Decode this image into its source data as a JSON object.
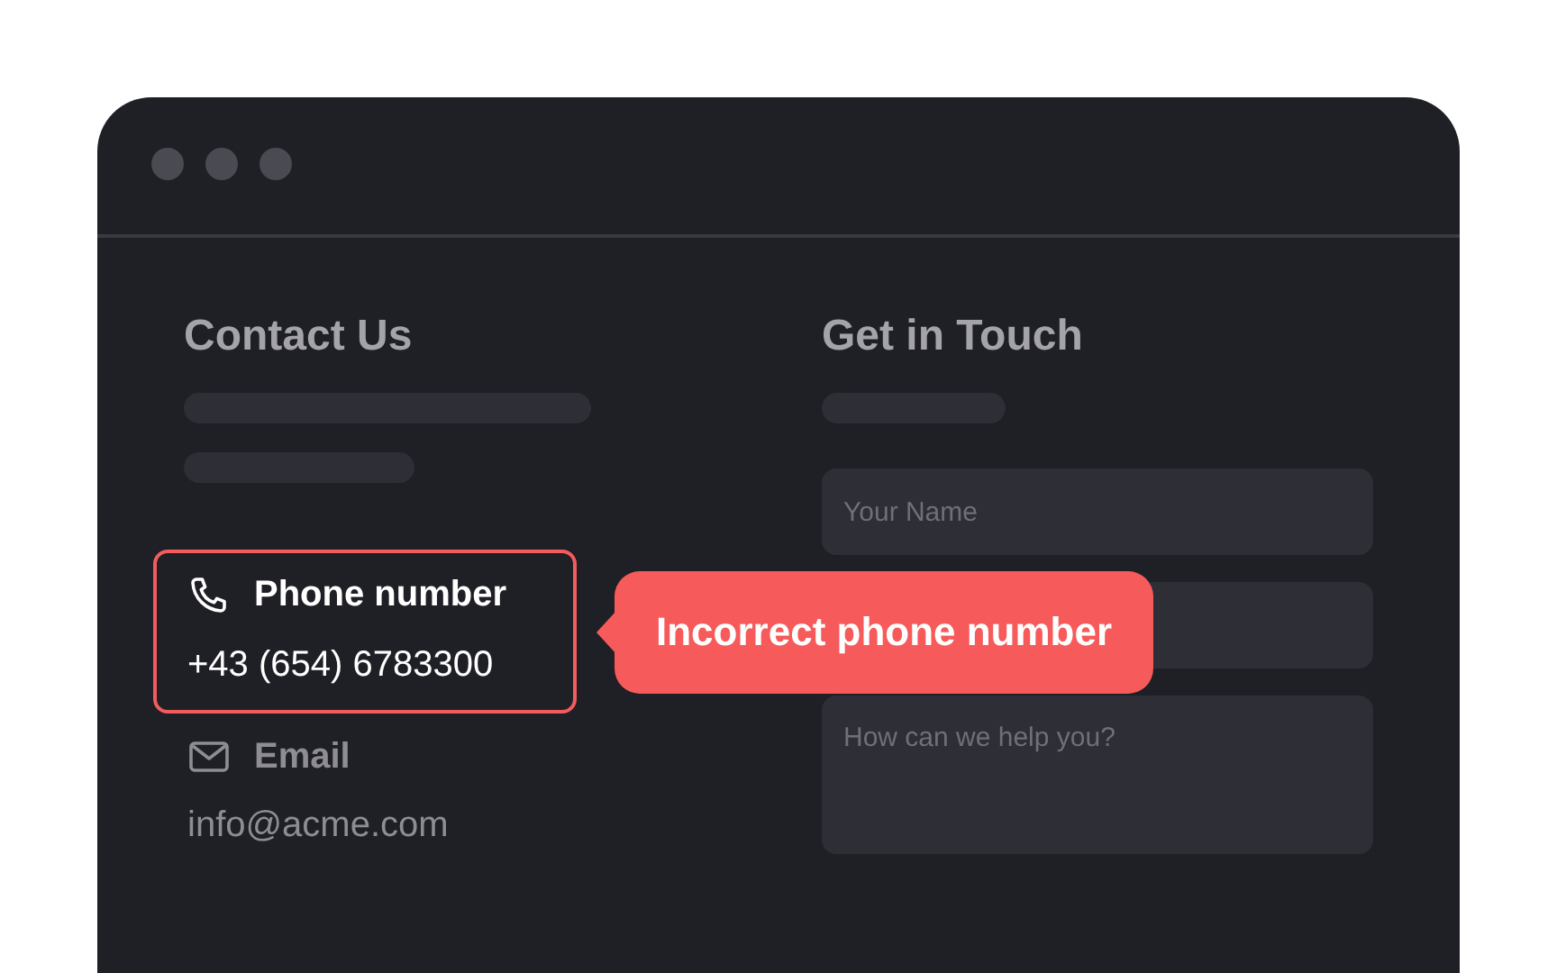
{
  "contact": {
    "title": "Contact Us",
    "items": [
      {
        "kind": "phone",
        "label": "Phone number",
        "value": "+43 (654) 6783300",
        "invalid": true
      },
      {
        "kind": "email",
        "label": "Email",
        "value": "info@acme.com",
        "invalid": false
      }
    ],
    "error_tooltip": "Incorrect phone number"
  },
  "form": {
    "title": "Get in Touch",
    "fields": [
      {
        "kind": "input",
        "placeholder": "Your Name"
      },
      {
        "kind": "input"
      },
      {
        "kind": "textarea",
        "placeholder": "How can we help you?"
      }
    ]
  }
}
